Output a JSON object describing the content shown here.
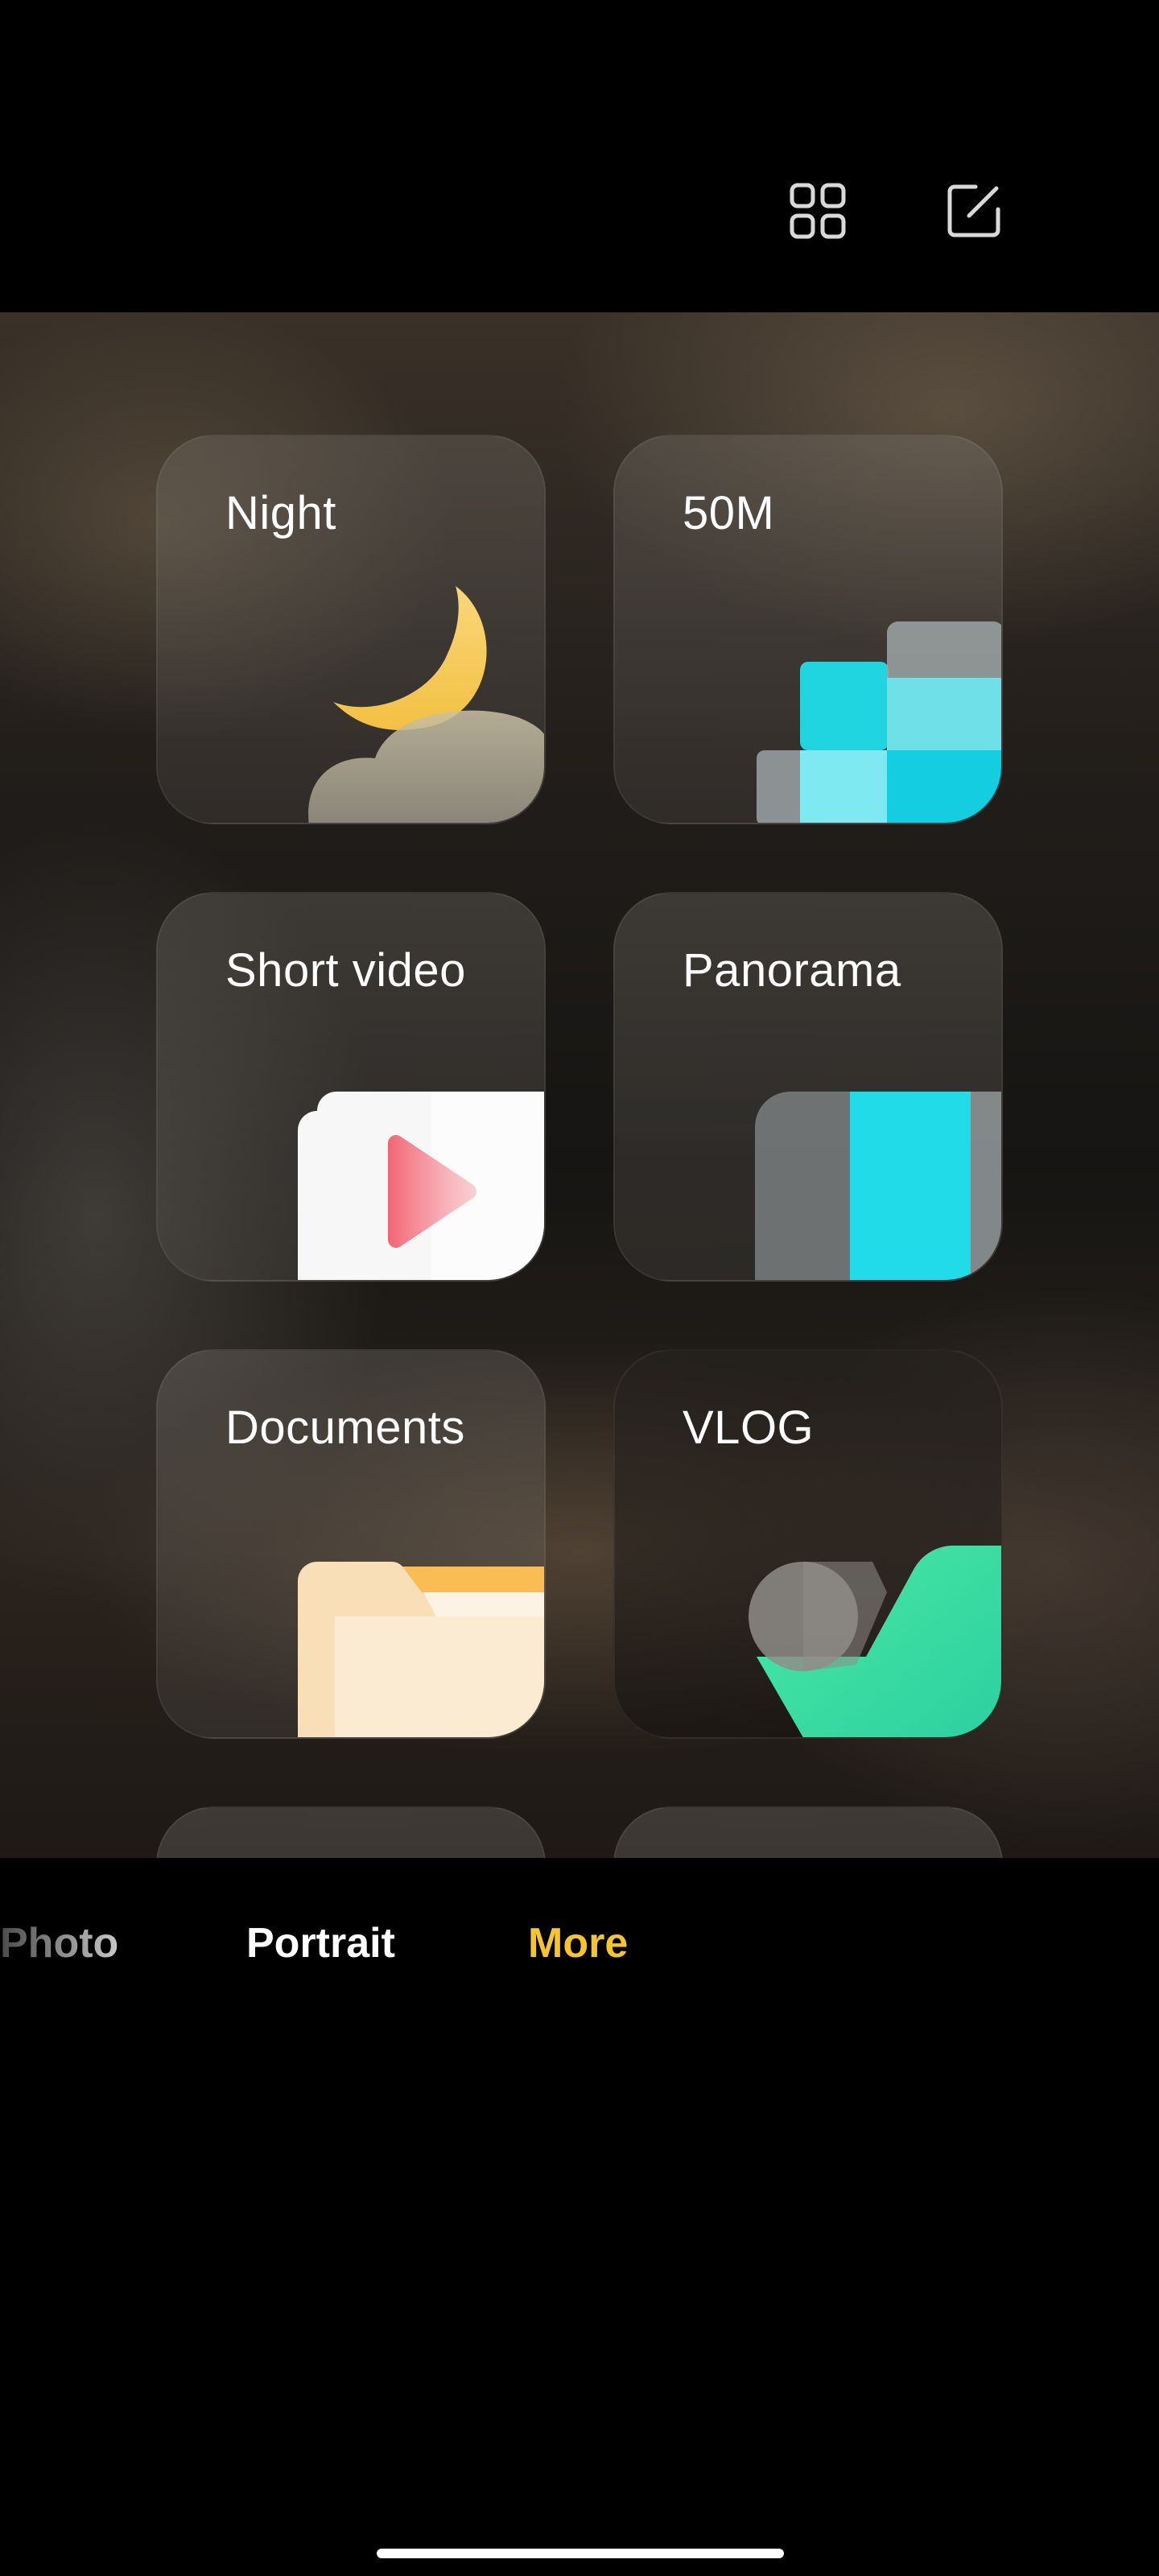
{
  "top_bar": {
    "icons": [
      "grid-icon",
      "edit-icon"
    ],
    "icon_color": "#d9d9d9"
  },
  "modes": [
    {
      "label": "Night",
      "icon": "moon-cloud-icon"
    },
    {
      "label": "50M",
      "icon": "high-resolution-icon"
    },
    {
      "label": "Short video",
      "icon": "play-icon"
    },
    {
      "label": "Panorama",
      "icon": "panorama-icon"
    },
    {
      "label": "Documents",
      "icon": "folder-icon"
    },
    {
      "label": "VLOG",
      "icon": "vlog-icon"
    }
  ],
  "mode_bar": {
    "tabs": [
      "Photo",
      "Portrait",
      "More"
    ],
    "active_tab": "More",
    "active_color": "#f5c531"
  }
}
